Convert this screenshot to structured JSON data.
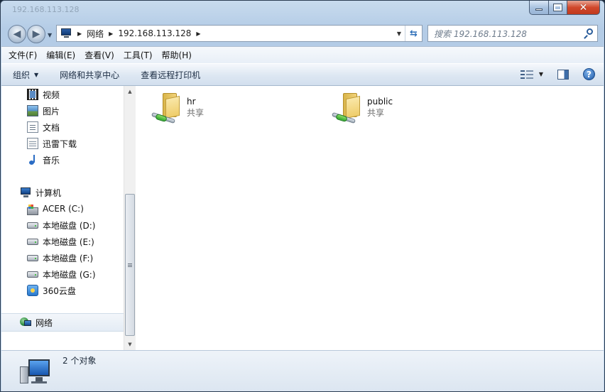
{
  "window": {
    "title": "192.168.113.128"
  },
  "address": {
    "crumbs": [
      "网络",
      "192.168.113.128"
    ]
  },
  "search": {
    "placeholder": "搜索 192.168.113.128"
  },
  "menubar": {
    "items": [
      "文件(F)",
      "编辑(E)",
      "查看(V)",
      "工具(T)",
      "帮助(H)"
    ]
  },
  "toolbar": {
    "organize": "组织",
    "network_center": "网络和共享中心",
    "printers": "查看远程打印机"
  },
  "sidebar": {
    "libraries": [
      "视频",
      "图片",
      "文档",
      "迅雷下载",
      "音乐"
    ],
    "computer": "计算机",
    "drives": [
      "ACER (C:)",
      "本地磁盘 (D:)",
      "本地磁盘 (E:)",
      "本地磁盘 (F:)",
      "本地磁盘 (G:)",
      "360云盘"
    ],
    "network": "网络"
  },
  "shares": [
    {
      "name": "hr",
      "type": "共享"
    },
    {
      "name": "public",
      "type": "共享"
    }
  ],
  "details": {
    "count": "2 个对象"
  },
  "icons": {
    "back": "back-arrow-icon",
    "forward": "forward-arrow-icon",
    "refresh": "refresh-icon",
    "search": "search-icon",
    "help": "help-icon",
    "folder_share": "network-share-folder-icon"
  }
}
